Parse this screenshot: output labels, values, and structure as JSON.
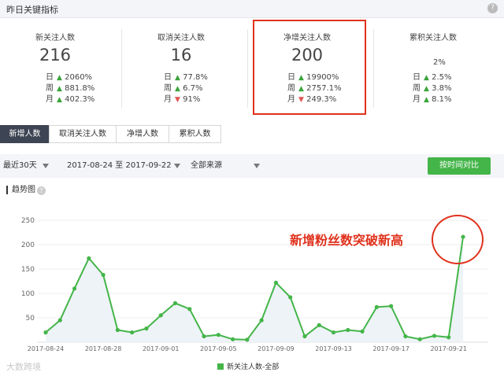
{
  "header": {
    "title": "昨日关键指标",
    "help": "?"
  },
  "metrics": [
    {
      "name": "新关注人数",
      "value": "216",
      "rows": [
        {
          "label": "日",
          "dir": "up",
          "value": "2060%"
        },
        {
          "label": "周",
          "dir": "up",
          "value": "881.8%"
        },
        {
          "label": "月",
          "dir": "up",
          "value": "402.3%"
        }
      ]
    },
    {
      "name": "取消关注人数",
      "value": "16",
      "rows": [
        {
          "label": "日",
          "dir": "up",
          "value": "77.8%"
        },
        {
          "label": "周",
          "dir": "up",
          "value": "6.7%"
        },
        {
          "label": "月",
          "dir": "down",
          "value": "91%"
        }
      ]
    },
    {
      "name": "净增关注人数",
      "value": "200",
      "rows": [
        {
          "label": "日",
          "dir": "up",
          "value": "19900%"
        },
        {
          "label": "周",
          "dir": "up",
          "value": "2757.1%"
        },
        {
          "label": "月",
          "dir": "down",
          "value": "249.3%"
        }
      ]
    },
    {
      "name": "累积关注人数",
      "value": "",
      "rows": [
        {
          "label": "日",
          "dir": "up",
          "value": "2.5%"
        },
        {
          "label": "周",
          "dir": "up",
          "value": "3.8%"
        },
        {
          "label": "月",
          "dir": "up",
          "value": "8.1%"
        }
      ],
      "extra": "2%"
    }
  ],
  "arrows": {
    "up": "▲",
    "down": "▼"
  },
  "tabs": [
    "新增人数",
    "取消关注人数",
    "净增人数",
    "累积人数"
  ],
  "filters": {
    "range": "最近30天",
    "dates": "2017-08-24 至 2017-09-22",
    "source": "全部来源",
    "compare": "按时间对比"
  },
  "trend": {
    "title": "趋势图",
    "help": "?"
  },
  "annotation": "新增粉丝数突破新高",
  "watermark": "大数跨境",
  "colors": {
    "line": "#44b549",
    "accent": "#e0321d",
    "tab_active": "#3d4454"
  },
  "chart_data": {
    "type": "line",
    "x": [
      "2017-08-24",
      "2017-08-25",
      "2017-08-26",
      "2017-08-27",
      "2017-08-28",
      "2017-08-29",
      "2017-08-30",
      "2017-08-31",
      "2017-09-01",
      "2017-09-02",
      "2017-09-03",
      "2017-09-04",
      "2017-09-05",
      "2017-09-06",
      "2017-09-07",
      "2017-09-08",
      "2017-09-09",
      "2017-09-10",
      "2017-09-11",
      "2017-09-12",
      "2017-09-13",
      "2017-09-14",
      "2017-09-15",
      "2017-09-16",
      "2017-09-17",
      "2017-09-18",
      "2017-09-19",
      "2017-09-20",
      "2017-09-21",
      "2017-09-22"
    ],
    "series": [
      {
        "name": "新关注人数-全部",
        "values": [
          20,
          45,
          110,
          172,
          138,
          25,
          20,
          28,
          55,
          80,
          68,
          12,
          15,
          6,
          5,
          45,
          122,
          92,
          12,
          35,
          20,
          25,
          22,
          72,
          74,
          12,
          6,
          13,
          10,
          216
        ]
      }
    ],
    "xticks": [
      "2017-08-24",
      "2017-08-28",
      "2017-09-01",
      "2017-09-05",
      "2017-09-09",
      "2017-09-13",
      "2017-09-17",
      "2017-09-21"
    ],
    "yticks": [
      50,
      100,
      150,
      200,
      250
    ],
    "ylim": [
      0,
      250
    ]
  }
}
